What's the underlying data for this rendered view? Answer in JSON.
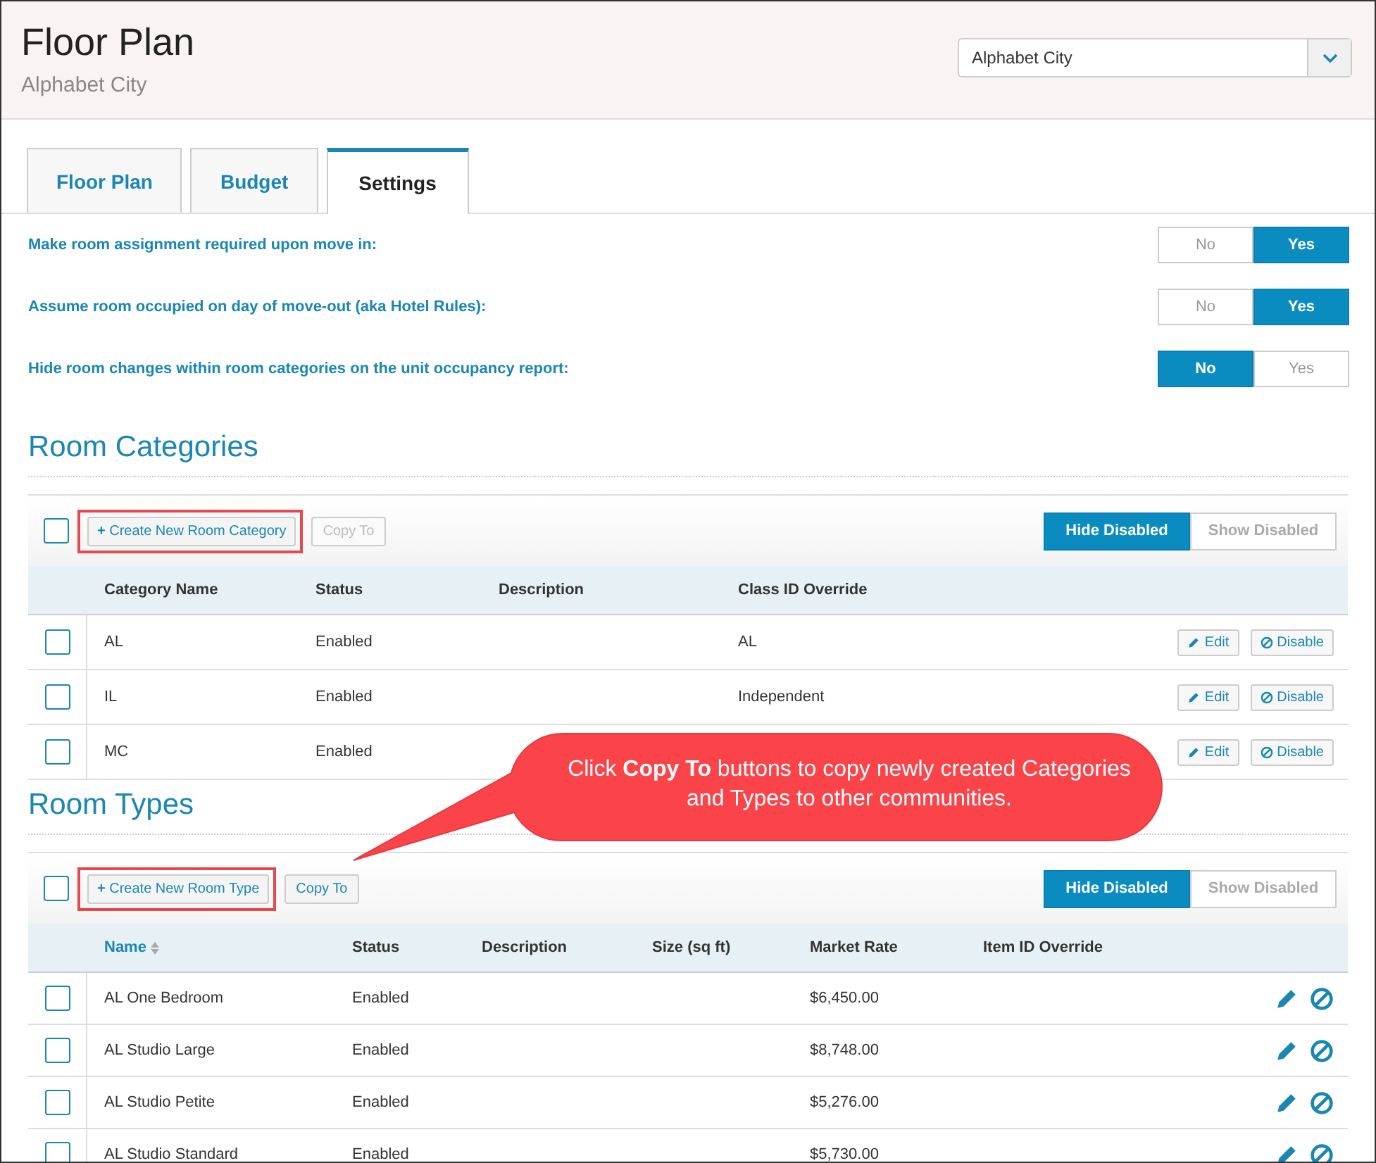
{
  "header": {
    "title": "Floor Plan",
    "subtitle": "Alphabet City",
    "community_select": {
      "value": "Alphabet City"
    }
  },
  "tabs": [
    {
      "label": "Floor Plan",
      "selected": false
    },
    {
      "label": "Budget",
      "selected": false
    },
    {
      "label": "Settings",
      "selected": true
    }
  ],
  "settings": [
    {
      "label": "Make room assignment required upon move in:",
      "options": [
        {
          "label": "No",
          "selected": false
        },
        {
          "label": "Yes",
          "selected": true
        }
      ]
    },
    {
      "label": "Assume room occupied on day of move-out (aka Hotel Rules):",
      "options": [
        {
          "label": "No",
          "selected": false
        },
        {
          "label": "Yes",
          "selected": true
        }
      ]
    },
    {
      "label": "Hide room changes within room categories on the unit occupancy report:",
      "options": [
        {
          "label": "No",
          "selected": true
        },
        {
          "label": "Yes",
          "selected": false
        }
      ]
    }
  ],
  "sections": [
    {
      "title": "Room Categories",
      "select_all_checked": false,
      "create_button": {
        "icon": "+",
        "label": "Create New Room Category",
        "highlighted": true
      },
      "copy_button": {
        "label": "Copy To",
        "disabled": true
      },
      "filter": [
        {
          "label": "Hide Disabled",
          "selected": true
        },
        {
          "label": "Show Disabled",
          "selected": false
        }
      ],
      "columns": [
        {
          "label": "Category Name",
          "sortable": false
        },
        {
          "label": "Status",
          "sortable": false
        },
        {
          "label": "Description",
          "sortable": false
        },
        {
          "label": "Class ID Override",
          "sortable": false
        }
      ],
      "rows": [
        {
          "cells": [
            "AL",
            "Enabled",
            "",
            "AL"
          ],
          "checked": false,
          "actions": [
            "Edit",
            "Disable"
          ]
        },
        {
          "cells": [
            "IL",
            "Enabled",
            "",
            "Independent"
          ],
          "checked": false,
          "actions": [
            "Edit",
            "Disable"
          ]
        },
        {
          "cells": [
            "MC",
            "Enabled",
            "",
            ""
          ],
          "checked": false,
          "actions": [
            "Edit",
            "Disable"
          ]
        }
      ]
    },
    {
      "title": "Room Types",
      "select_all_checked": false,
      "create_button": {
        "icon": "+",
        "label": "Create New Room Type",
        "highlighted": true
      },
      "copy_button": {
        "label": "Copy To",
        "disabled": false
      },
      "filter": [
        {
          "label": "Hide Disabled",
          "selected": true
        },
        {
          "label": "Show Disabled",
          "selected": false
        }
      ],
      "columns": [
        {
          "label": "Name",
          "sortable": true
        },
        {
          "label": "Status",
          "sortable": false
        },
        {
          "label": "Description",
          "sortable": false
        },
        {
          "label": "Size (sq ft)",
          "sortable": false
        },
        {
          "label": "Market Rate",
          "sortable": false
        },
        {
          "label": "Item ID Override",
          "sortable": false
        }
      ],
      "rows": [
        {
          "cells": [
            "AL One Bedroom",
            "Enabled",
            "",
            "",
            "$6,450.00",
            ""
          ],
          "checked": false
        },
        {
          "cells": [
            "AL Studio Large",
            "Enabled",
            "",
            "",
            "$8,748.00",
            ""
          ],
          "checked": false
        },
        {
          "cells": [
            "AL Studio Petite",
            "Enabled",
            "",
            "",
            "$5,276.00",
            ""
          ],
          "checked": false
        },
        {
          "cells": [
            "AL Studio Standard",
            "Enabled",
            "",
            "",
            "$5,730.00",
            ""
          ],
          "checked": false
        }
      ]
    }
  ],
  "callout": {
    "text": "Click **Copy To** buttons to copy newly created Categories and Types to other communities."
  }
}
